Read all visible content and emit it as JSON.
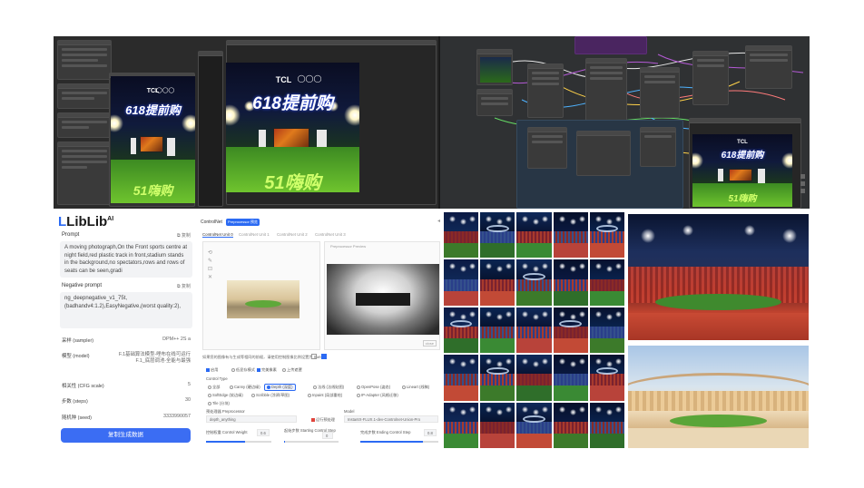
{
  "poster": {
    "brand": "TCL",
    "headline": "618提前购",
    "bottom_text": "51嗨购"
  },
  "liblib": {
    "logo": "LibLib",
    "logo_sup": "AI",
    "prompt_label": "Prompt",
    "copy_label": "复制",
    "prompt_text": "A moving photograph,On the Front sports centre at night field,red plastic track in front,stadium stands in the background,no spectators,rows and rows of seats can be seen,gradi",
    "negative_label": "Negative prompt",
    "negative_copy_label": "复制",
    "negative_text": "ng_deepnegative_v1_75t,(badhandv4:1.2),EasyNegative,(worst quality:2),",
    "params": [
      {
        "key": "采样 (sampler)",
        "value": "DPM++ 2S a"
      },
      {
        "key": "模型 (model)",
        "value": "F.1基础算法模型-哩布在线可运行\nF.1_底层调池-全能与最强"
      },
      {
        "key": "相关性 (CFG scale)",
        "value": "5"
      },
      {
        "key": "步数 (steps)",
        "value": "30"
      },
      {
        "key": "随机种 (seed)",
        "value": "3333990057"
      }
    ],
    "button_label": "复制生成数据"
  },
  "controlnet": {
    "title": "ControlNet",
    "badge": "Preprocessor 预览",
    "tabs": [
      "ControlNet Unit 0",
      "ControlNet Unit 1",
      "ControlNet Unit 2",
      "ControlNet Unit 3"
    ],
    "preview_label": "Preprocessor Preview",
    "note": "如果您的图像有与生成等相同的前缀，请使用控制图像比例设置为 Sweet",
    "checks": [
      "启用",
      "低显存模式",
      "完美像素",
      "上传遮罩"
    ],
    "control_type_label": "Control Type",
    "control_types": [
      "全部",
      "Canny (硬边缘)",
      "Depth (深度)",
      "法线 (法线贴图)",
      "OpenPose (姿态)",
      "Lineart (线稿)",
      "SoftEdge (软边缘)",
      "Scribble (涂鸦/草图)",
      "Inpaint (局部重绘)",
      "IP-Adapter (风格迁移)",
      "Tile (分块)",
      "Recolor (重上色)"
    ],
    "active_type": "Depth (深度)",
    "preprocessor_label": "预处理器 Preprocessor",
    "preprocessor_value": "depth_anything",
    "model_label": "Model",
    "model_value": "InstantX-FLUX.1-dev-Controlnet-Union-Pro",
    "run_label": "运行预处理",
    "weight_label": "控制权重 Control Weight",
    "weight_value": "0.6",
    "start_label": "起始步数 Starting Control Step",
    "start_value": "0",
    "end_label": "完成步数 Ending Control Step",
    "end_value": "0.8"
  },
  "colors": {
    "accent": "#2b6af3",
    "editor_bg": "#2b2b2b",
    "grass": "#6fc42e"
  }
}
